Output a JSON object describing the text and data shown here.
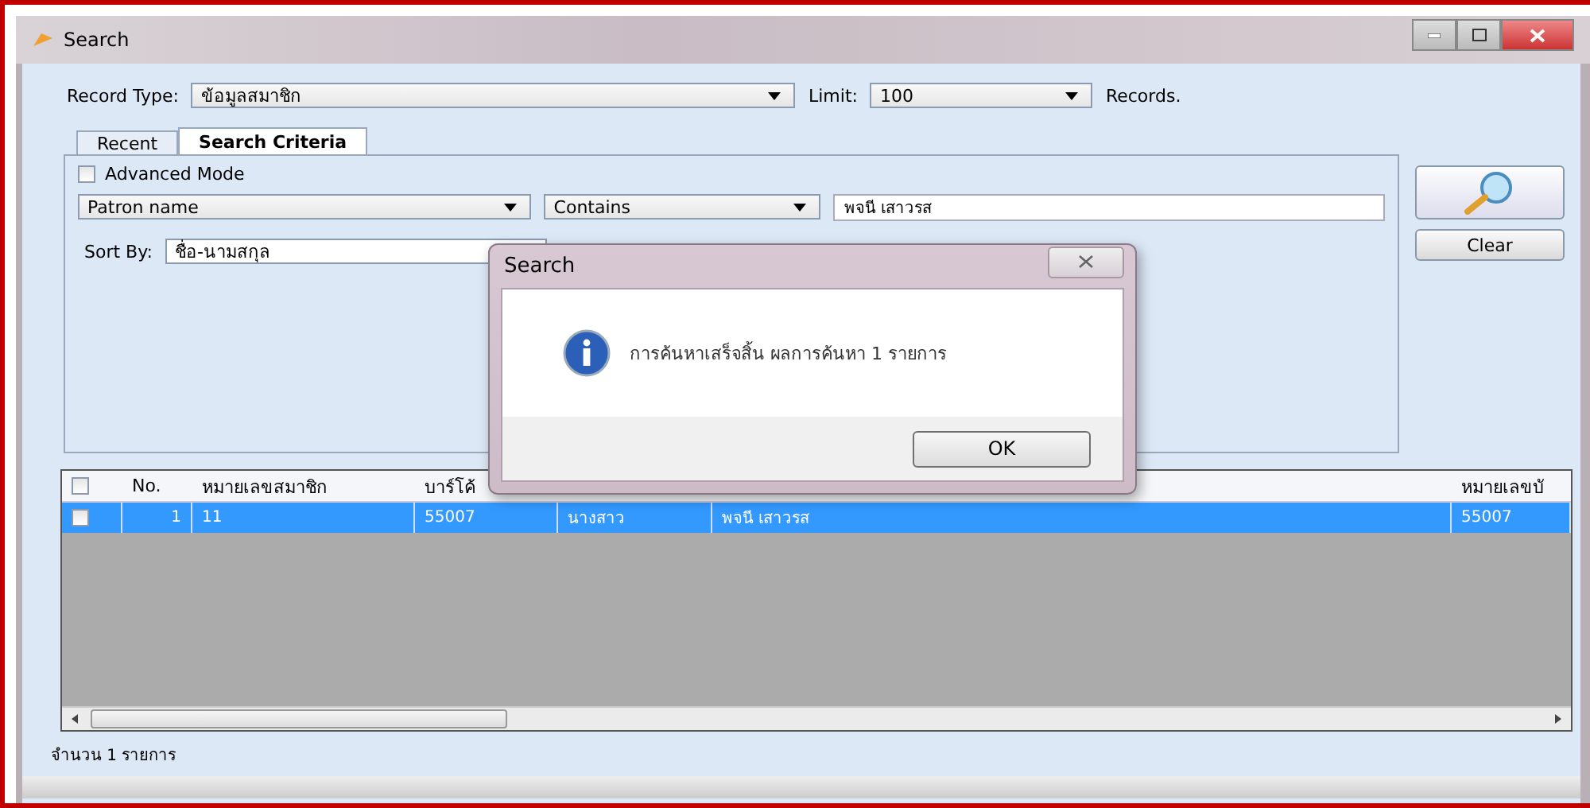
{
  "window": {
    "title": "Search"
  },
  "record_type": {
    "label": "Record Type:",
    "value": "ข้อมูลสมาชิก"
  },
  "limit": {
    "label": "Limit:",
    "value": "100",
    "suffix": "Records."
  },
  "tabs": [
    {
      "label": "Recent",
      "selected": false
    },
    {
      "label": "Search Criteria",
      "selected": true
    }
  ],
  "advanced_mode": {
    "label": "Advanced Mode",
    "checked": false
  },
  "criteria": {
    "field": "Patron name",
    "operator": "Contains",
    "value": "พจนี เสาวรส"
  },
  "sort": {
    "label": "Sort By:",
    "value": "ชื่อ-นามสกุล"
  },
  "clear_button": "Clear",
  "table": {
    "select_all": {
      "checked": false
    },
    "columns": [
      {
        "kind": "text",
        "label": "No."
      },
      {
        "kind": "text",
        "label": "หมายเลขสมาชิก"
      },
      {
        "kind": "text",
        "label": "บาร์โค้"
      },
      {
        "kind": "text"
      },
      {
        "kind": "text"
      },
      {
        "kind": "text",
        "label": "หมายเลขบั"
      }
    ],
    "rows": [
      {
        "checked": false,
        "selected": true,
        "cells": [
          "1",
          "11",
          "55007",
          "นางสาว",
          "พจนี เสาวรส",
          "55007"
        ]
      }
    ]
  },
  "status_bar": "จำนวน 1 รายการ",
  "dialog": {
    "title": "Search",
    "message": "การค้นหาเสร็จสิ้น ผลการค้นหา 1 รายการ",
    "button": "OK"
  }
}
